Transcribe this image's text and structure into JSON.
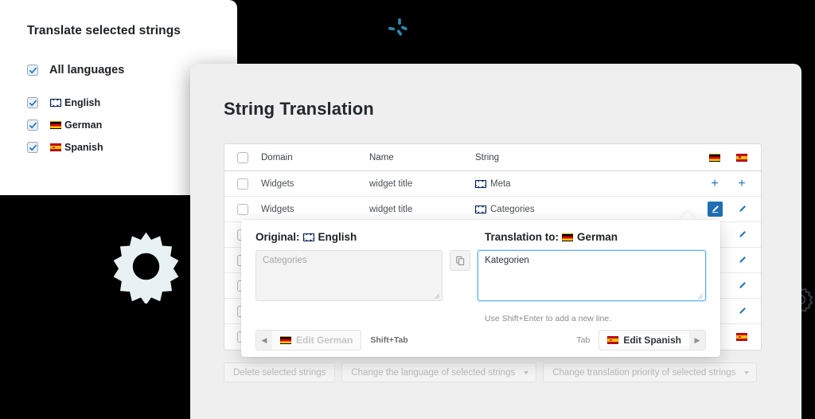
{
  "language_card": {
    "title": "Translate selected strings",
    "all_languages_label": "All languages",
    "all_languages_checked": true,
    "languages": [
      {
        "label": "English",
        "flag": "flag-gb",
        "checked": true
      },
      {
        "label": "German",
        "flag": "flag-de",
        "checked": true
      },
      {
        "label": "Spanish",
        "flag": "flag-es",
        "checked": true
      }
    ]
  },
  "panel": {
    "title": "String Translation",
    "table": {
      "columns": [
        "Domain",
        "Name",
        "String"
      ],
      "flag_columns": [
        {
          "name": "german-column",
          "flag": "flag-de"
        },
        {
          "name": "spanish-column",
          "flag": "flag-es"
        }
      ],
      "rows": [
        {
          "domain": "Widgets",
          "name": "widget title",
          "string": "Meta",
          "string_flag": "flag-gb",
          "german_action": "+",
          "spanish_action": "+",
          "german_icon": "plus-icon",
          "spanish_icon": "plus-icon"
        },
        {
          "domain": "Widgets",
          "name": "widget title",
          "string": "Categories",
          "string_flag": "flag-gb",
          "german_action": "",
          "spanish_action": "",
          "german_icon": "pencil-icon-active",
          "spanish_icon": "pencil-icon"
        },
        {
          "domain": "",
          "name": "",
          "string": "",
          "german_icon": "pencil-icon",
          "spanish_icon": "pencil-icon"
        },
        {
          "domain": "",
          "name": "",
          "string": "",
          "german_icon": "pencil-icon",
          "spanish_icon": "pencil-icon"
        },
        {
          "domain": "",
          "name": "",
          "string": "",
          "german_icon": "pencil-icon",
          "spanish_icon": "pencil-icon"
        },
        {
          "domain": "",
          "name": "",
          "string": "",
          "german_icon": "pencil-icon",
          "spanish_icon": "pencil-icon"
        },
        {
          "domain": "",
          "name": "",
          "string": "",
          "german_icon": "",
          "spanish_icon": "spanish-flag-icon"
        }
      ]
    },
    "editor_popup": {
      "original_label": "Original:",
      "original_language": "English",
      "original_flag": "flag-gb",
      "original_value": "",
      "original_placeholder": "Categories",
      "copy_icon": "copy-icon",
      "translation_label": "Translation to:",
      "translation_language": "German",
      "translation_flag": "flag-de",
      "translation_value": "Kategorien",
      "hint": "Use Shift+Enter to add a new line.",
      "prev_button": {
        "label": "Edit German",
        "flag": "flag-de",
        "shortcut": "Shift+Tab",
        "disabled": true
      },
      "next_button": {
        "label": "Edit Spanish",
        "flag": "flag-es",
        "shortcut": "Tab",
        "disabled": false
      }
    },
    "bulk_actions": [
      {
        "label": "Delete selected strings",
        "type": "button"
      },
      {
        "label": "Change the language of selected strings",
        "type": "select"
      },
      {
        "label": "Change translation priority of selected strings",
        "type": "select"
      }
    ]
  },
  "decorations": {
    "gear_large": "gear-icon",
    "gear_small": "gear-icon",
    "spinner": "loading-spinner-icon",
    "spinner_color": "#2a8cb0",
    "accent_color": "#2271b1",
    "panel_background": "#efefef",
    "page_background": "#000000"
  }
}
